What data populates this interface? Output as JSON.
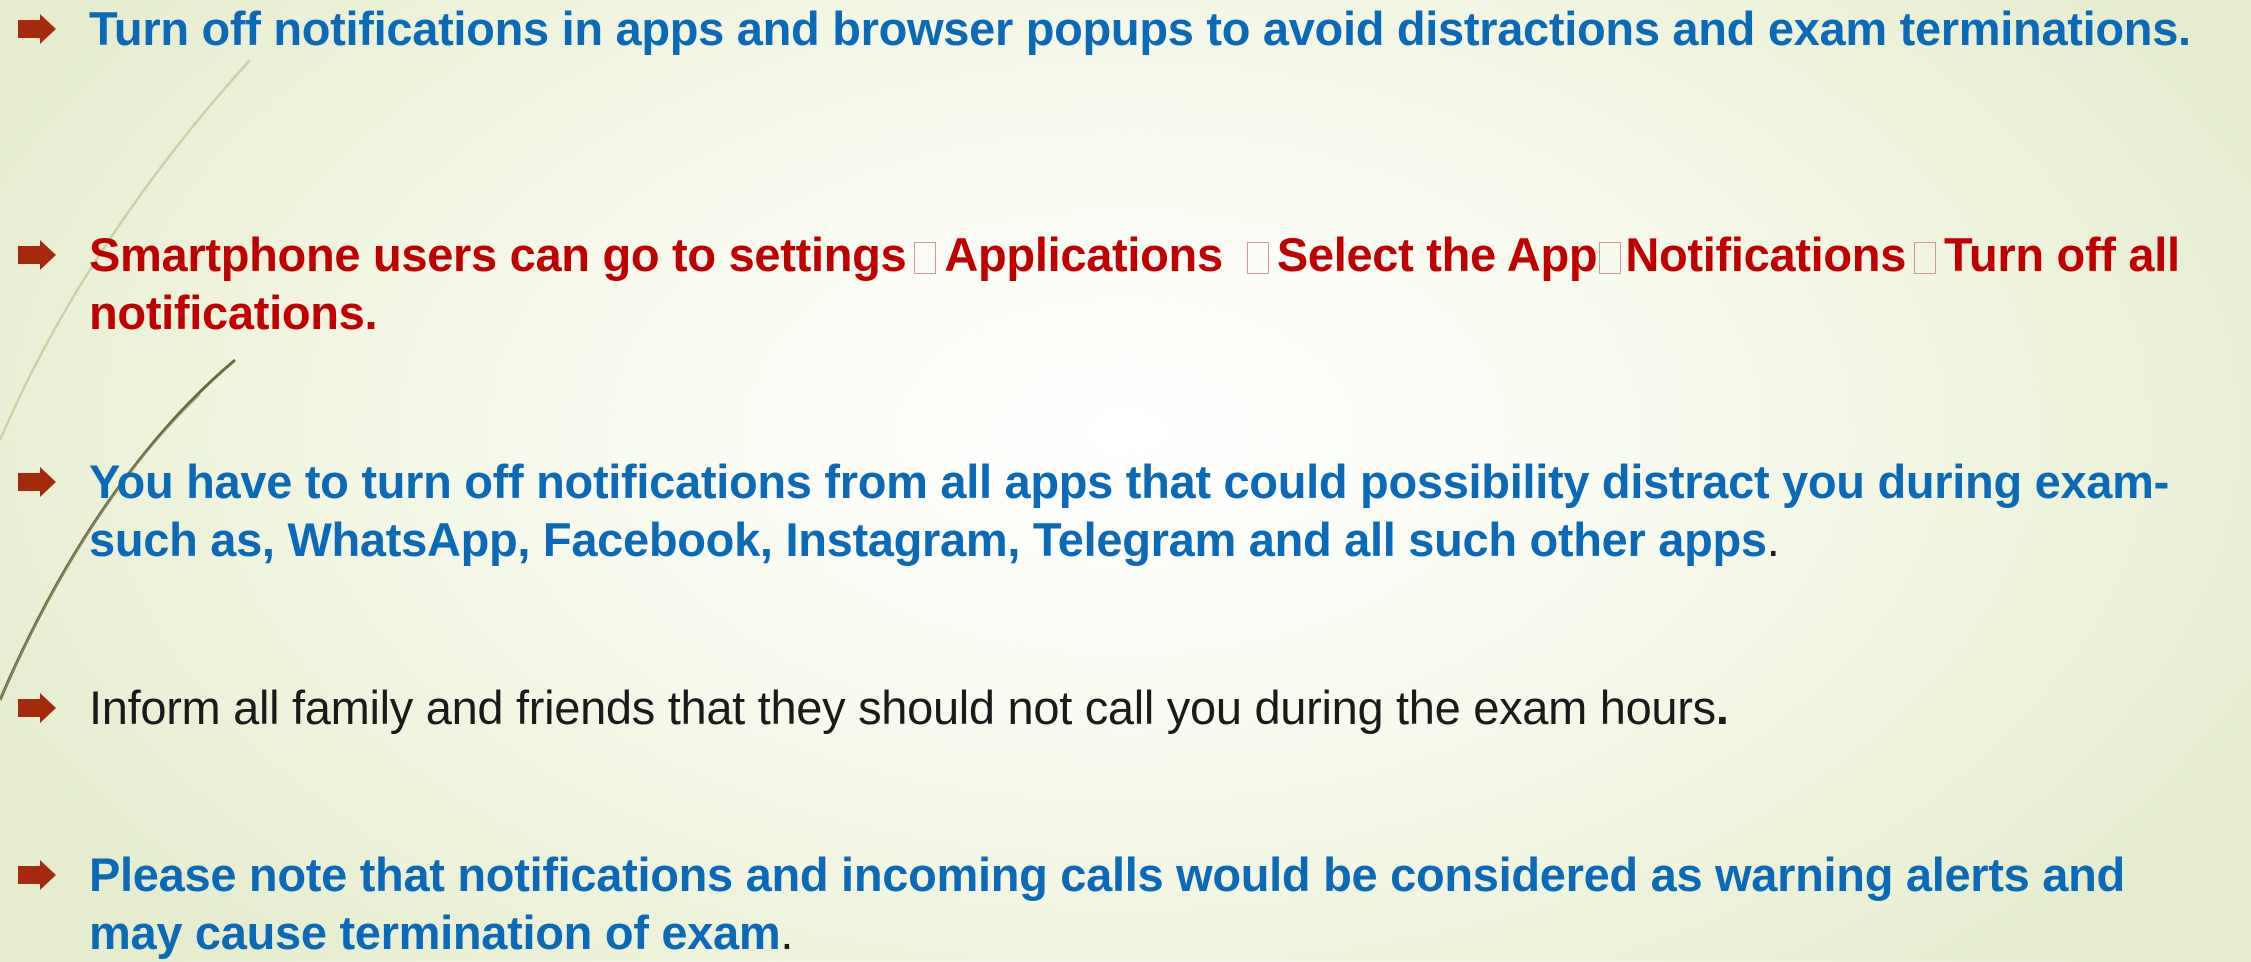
{
  "colors": {
    "blue": "#0a6ab8",
    "red": "#c00000",
    "dark": "#1a1a1a",
    "bullet_marker": "#a52a0c"
  },
  "bullets": [
    {
      "icon": "arrow-bullet-icon",
      "text": "Turn off notifications in apps and browser popups to avoid distractions and exam terminations."
    },
    {
      "icon": "arrow-bullet-icon",
      "parts": [
        "Smartphone users can go to settings",
        "Applications",
        "Select the App",
        "Notifications",
        "Turn off all notifications."
      ]
    },
    {
      "icon": "arrow-bullet-icon",
      "text": "You have to turn off notifications from all apps that could possibility distract you during exam- such as, WhatsApp, Facebook, Instagram, Telegram and all such other apps",
      "suffix": "."
    },
    {
      "icon": "arrow-bullet-icon",
      "text": "Inform all family and friends that they should not call you during the exam hours",
      "suffix": "."
    },
    {
      "icon": "arrow-bullet-icon",
      "text": "Please note that notifications and incoming calls would be considered as warning alerts and may cause termination of exam",
      "suffix": "."
    }
  ]
}
